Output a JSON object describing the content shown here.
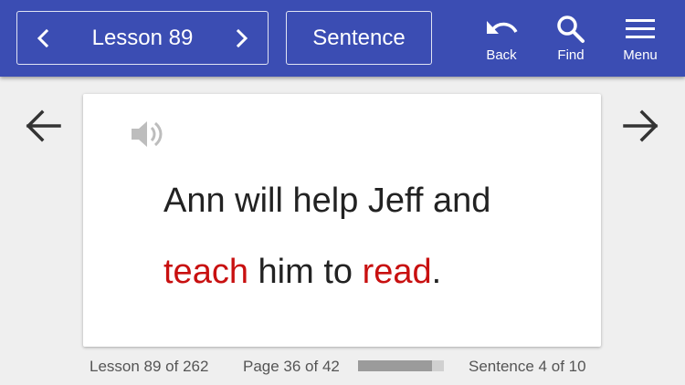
{
  "header": {
    "lesson_label": "Lesson 89",
    "mode_label": "Sentence",
    "tools": {
      "back_label": "Back",
      "find_label": "Find",
      "menu_label": "Menu"
    }
  },
  "card": {
    "speaker_icon": "speaker-icon",
    "sentence_parts": [
      {
        "text": "Ann will help Jeff and",
        "highlight": false
      },
      {
        "text": "teach",
        "highlight": true
      },
      {
        "text": " him to ",
        "highlight": false
      },
      {
        "text": "read",
        "highlight": true
      },
      {
        "text": ".",
        "highlight": false
      }
    ]
  },
  "footer": {
    "lesson_progress": "Lesson 89 of 262",
    "page_progress": "Page 36 of 42",
    "page_fraction": 0.857,
    "sentence_progress": "Sentence 4 of 10"
  },
  "colors": {
    "header_bg": "#3b4db3",
    "highlight": "#c81010"
  }
}
